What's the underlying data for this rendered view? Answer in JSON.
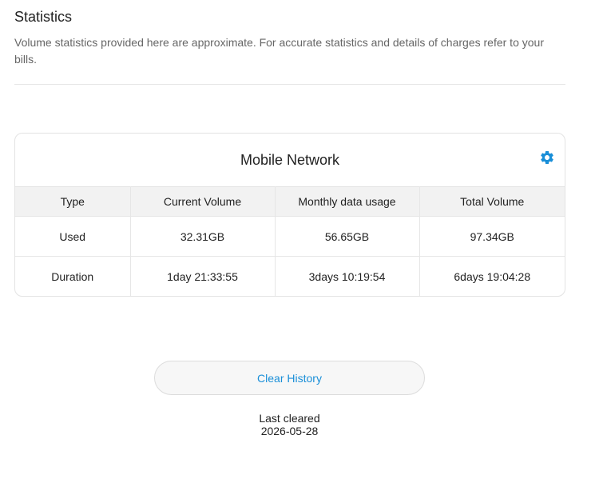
{
  "page": {
    "title": "Statistics",
    "description": "Volume statistics provided here are approximate. For accurate statistics and details of charges refer to your bills."
  },
  "card": {
    "title": "Mobile Network",
    "settings_icon": "gear-icon",
    "accent_color": "#1a8fd8"
  },
  "table": {
    "headers": [
      "Type",
      "Current Volume",
      "Monthly data usage",
      "Total Volume"
    ],
    "rows": [
      [
        "Used",
        "32.31GB",
        "56.65GB",
        "97.34GB"
      ],
      [
        "Duration",
        "1day 21:33:55",
        "3days 10:19:54",
        "6days 19:04:28"
      ]
    ]
  },
  "actions": {
    "clear_label": "Clear History"
  },
  "last_cleared": {
    "label": "Last cleared",
    "date": "2026-05-28"
  }
}
